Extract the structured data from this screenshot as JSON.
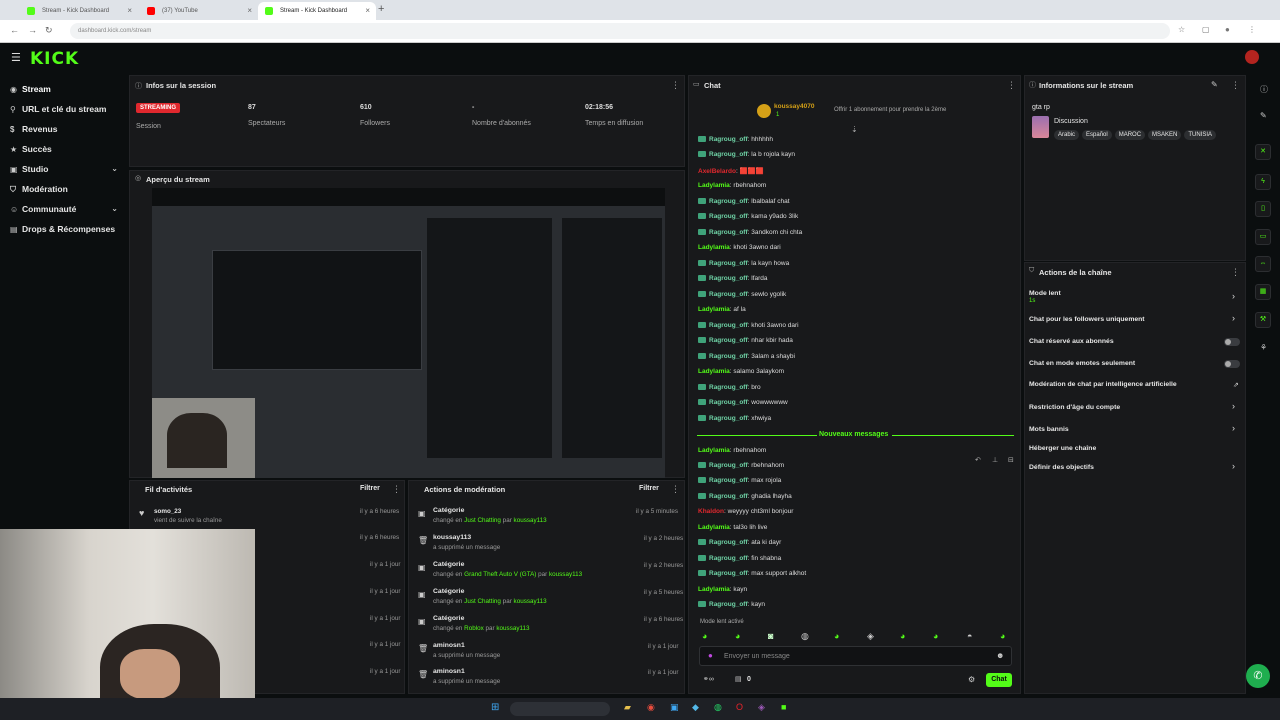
{
  "browser": {
    "tabs": [
      {
        "title": "Stream - Kick Dashboard",
        "color": "#53fc18"
      },
      {
        "title": "(37) YouTube",
        "color": "#ff0000"
      },
      {
        "title": "Stream - Kick Dashboard",
        "color": "#53fc18"
      }
    ],
    "url": "dashboard.kick.com/stream",
    "new_tab": "+"
  },
  "header": {
    "logo": "KICK"
  },
  "sidebar": {
    "items": [
      {
        "label": "Stream",
        "icon": "broadcast-icon"
      },
      {
        "label": "URL et clé du stream",
        "icon": "link-icon"
      },
      {
        "label": "Revenus",
        "icon": "money-icon"
      },
      {
        "label": "Succès",
        "icon": "trophy-icon"
      },
      {
        "label": "Studio",
        "icon": "studio-icon"
      },
      {
        "label": "Modération",
        "icon": "shield-icon"
      },
      {
        "label": "Communauté",
        "icon": "users-icon"
      },
      {
        "label": "Drops & Récompenses",
        "icon": "gift-icon"
      }
    ]
  },
  "session": {
    "title": "Infos sur la session",
    "badge": "STREAMING",
    "badge_label": "Session",
    "stats": [
      {
        "value": "87",
        "label": "Spectateurs"
      },
      {
        "value": "610",
        "label": "Followers"
      },
      {
        "value": "-",
        "label": "Nombre d'abonnés"
      },
      {
        "value": "02:18:56",
        "label": "Temps en diffusion"
      }
    ]
  },
  "preview": {
    "title": "Aperçu du stream"
  },
  "activity": {
    "title": "Fil d'activités",
    "filter": "Filtrer",
    "rows": [
      {
        "user": "somo_23",
        "text": "vient de suivre la chaîne",
        "time": "il y a 6 heures"
      },
      {
        "time": "il y a 6 heures"
      },
      {
        "time": "il y a 1 jour"
      },
      {
        "time": "il y a 1 jour"
      },
      {
        "time": "il y a 1 jour"
      },
      {
        "time": "il y a 1 jour"
      },
      {
        "time": "il y a 1 jour"
      }
    ]
  },
  "moderation": {
    "title": "Actions de modération",
    "filter": "Filtrer",
    "rows": [
      {
        "title": "Catégorie",
        "pre": "changé en ",
        "hl": "Just Chatting",
        "mid": " par ",
        "by": "koussay113",
        "time": "il y a 5 minutes"
      },
      {
        "title": "koussay113",
        "pre": "a supprimé un message",
        "hl": "",
        "mid": "",
        "by": "",
        "time": "il y a 2 heures"
      },
      {
        "title": "Catégorie",
        "pre": "changé en ",
        "hl": "Grand Theft Auto V (GTA)",
        "mid": " par ",
        "by": "koussay113",
        "time": "il y a 2 heures"
      },
      {
        "title": "Catégorie",
        "pre": "changé en ",
        "hl": "Just Chatting",
        "mid": " par ",
        "by": "koussay113",
        "time": "il y a 5 heures"
      },
      {
        "title": "Catégorie",
        "pre": "changé en ",
        "hl": "Roblox",
        "mid": " par ",
        "by": "koussay113",
        "time": "il y a 6 heures"
      },
      {
        "title": "aminosn1",
        "pre": "a supprimé un message",
        "hl": "",
        "mid": "",
        "by": "",
        "time": "il y a 1 jour"
      },
      {
        "title": "aminosn1",
        "pre": "a supprimé un message",
        "hl": "",
        "mid": "",
        "by": "",
        "time": "il y a 1 jour"
      }
    ]
  },
  "chat": {
    "title": "Chat",
    "pinned_user": "koussay4070",
    "pinned_sub": "1",
    "pinned_text": "Offrir 1 abonnement pour prendre la 2ème",
    "new_messages": "Nouveaux messages",
    "slow_mode": "Mode lent activé",
    "placeholder": "Envoyer un message",
    "counter": "0",
    "send": "Chat",
    "messages": [
      {
        "user": "Ragroug_off",
        "text": "hhhhhh",
        "color": "#6fd3a6"
      },
      {
        "user": "Ragroug_off",
        "text": "la b rojola kayn",
        "color": "#6fd3a6"
      },
      {
        "user": "AxelBelardo",
        "text": "🟥🟥🟥",
        "color": "#e0282e"
      },
      {
        "user": "Ladylamia",
        "text": "rbehnahom",
        "color": "#53fc18"
      },
      {
        "user": "Ragroug_off",
        "text": "lbalbalaf chat",
        "color": "#6fd3a6"
      },
      {
        "user": "Ragroug_off",
        "text": "kama y9ado 3lik",
        "color": "#6fd3a6"
      },
      {
        "user": "Ragroug_off",
        "text": "3andkom chi chta",
        "color": "#6fd3a6"
      },
      {
        "user": "Ladylamia",
        "text": "khoti 3awno dari",
        "color": "#53fc18"
      },
      {
        "user": "Ragroug_off",
        "text": "la kayn howa",
        "color": "#6fd3a6"
      },
      {
        "user": "Ragroug_off",
        "text": "lfarda",
        "color": "#6fd3a6"
      },
      {
        "user": "Ragroug_off",
        "text": "sewlo ygolik",
        "color": "#6fd3a6"
      },
      {
        "user": "Ladylamia",
        "text": "af la",
        "color": "#53fc18"
      },
      {
        "user": "Ragroug_off",
        "text": "khoti 3awno dari",
        "color": "#6fd3a6"
      },
      {
        "user": "Ragroug_off",
        "text": "nhar kbir hada",
        "color": "#6fd3a6"
      },
      {
        "user": "Ragroug_off",
        "text": "3alam a shaybi",
        "color": "#6fd3a6"
      },
      {
        "user": "Ladylamia",
        "text": "salamo 3alaykom",
        "color": "#53fc18"
      },
      {
        "user": "Ragroug_off",
        "text": "bro",
        "color": "#6fd3a6"
      },
      {
        "user": "Ragroug_off",
        "text": "wowwwwww",
        "color": "#6fd3a6"
      },
      {
        "user": "Ragroug_off",
        "text": "xhwiya",
        "color": "#6fd3a6"
      },
      {
        "user": "Ladylamia",
        "text": "rbehnahom",
        "color": "#53fc18"
      },
      {
        "user": "Ragroug_off",
        "text": "rbehnahom",
        "color": "#6fd3a6"
      },
      {
        "user": "Ragroug_off",
        "text": "max rojola",
        "color": "#6fd3a6"
      },
      {
        "user": "Ragroug_off",
        "text": "ghadia lhayha",
        "color": "#6fd3a6"
      },
      {
        "user": "Khaldon",
        "text": "weyyyy cht3ml bonjour",
        "color": "#e0282e"
      },
      {
        "user": "Ladylamia",
        "text": "tal3o lih live",
        "color": "#53fc18"
      },
      {
        "user": "Ragroug_off",
        "text": "ata ki dayr",
        "color": "#6fd3a6"
      },
      {
        "user": "Ragroug_off",
        "text": "fin shabna",
        "color": "#6fd3a6"
      },
      {
        "user": "Ragroug_off",
        "text": "max support alkhot",
        "color": "#6fd3a6"
      },
      {
        "user": "Ladylamia",
        "text": "kayn",
        "color": "#53fc18"
      },
      {
        "user": "Ragroug_off",
        "text": "kayn",
        "color": "#6fd3a6"
      }
    ]
  },
  "stream_info": {
    "title": "Informations sur le stream",
    "stream_title": "gta rp",
    "category": "Discussion",
    "tags": [
      "Arabic",
      "Español",
      "MAROC",
      "MSAKEN",
      "TUNISIA"
    ]
  },
  "channel_actions": {
    "title": "Actions de la chaîne",
    "slow_mode_label": "Mode lent",
    "slow_mode_value": "1s",
    "items": [
      {
        "label": "Chat pour les followers uniquement",
        "control": "chevron"
      },
      {
        "label": "Chat réservé aux abonnés",
        "control": "toggle"
      },
      {
        "label": "Chat en mode emotes seulement",
        "control": "toggle"
      },
      {
        "label": "Modération de chat par intelligence artificielle",
        "control": "link"
      },
      {
        "label": "Restriction d'âge du compte",
        "control": "chevron"
      },
      {
        "label": "Mots bannis",
        "control": "chevron"
      },
      {
        "label": "Héberger une chaîne",
        "control": "none"
      },
      {
        "label": "Définir des objectifs",
        "control": "chevron"
      }
    ]
  },
  "colors": {
    "accent": "#53fc18",
    "live": "#e0282e",
    "panel": "#18191b",
    "bg": "#0b0e0f"
  }
}
